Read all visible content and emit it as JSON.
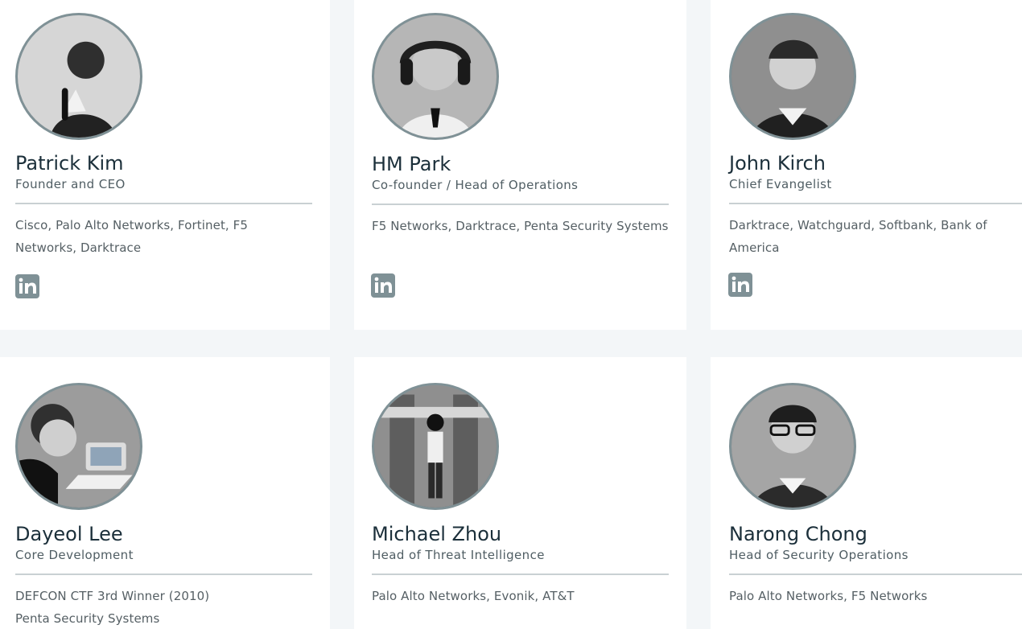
{
  "team": [
    {
      "name": "Patrick Kim",
      "role": "Founder and CEO",
      "background": "Cisco, Palo Alto Networks, Fortinet, F5 Networks, Darktrace",
      "icon": "linkedin-icon"
    },
    {
      "name": "HM Park",
      "role": "Co-founder / Head of Operations",
      "background": "F5 Networks, Darktrace, Penta Security Systems",
      "icon": "linkedin-icon"
    },
    {
      "name": "John Kirch",
      "role": "Chief Evangelist",
      "background": "Darktrace, Watchguard, Softbank, Bank of America",
      "icon": "linkedin-icon"
    },
    {
      "name": "Dayeol Lee",
      "role": "Core Development",
      "background": "DEFCON CTF 3rd Winner (2010)\nPenta Security Systems"
    },
    {
      "name": "Michael Zhou",
      "role": "Head of Threat Intelligence",
      "background": "Palo Alto Networks, Evonik, AT&T"
    },
    {
      "name": "Narong Chong",
      "role": "Head of Security Operations",
      "background": "Palo Alto Networks, F5 Networks"
    }
  ],
  "colors": {
    "page_background": "#f3f6f8",
    "card_background": "#ffffff",
    "accent": "#7f9196",
    "name_text": "#1b2f3a"
  }
}
